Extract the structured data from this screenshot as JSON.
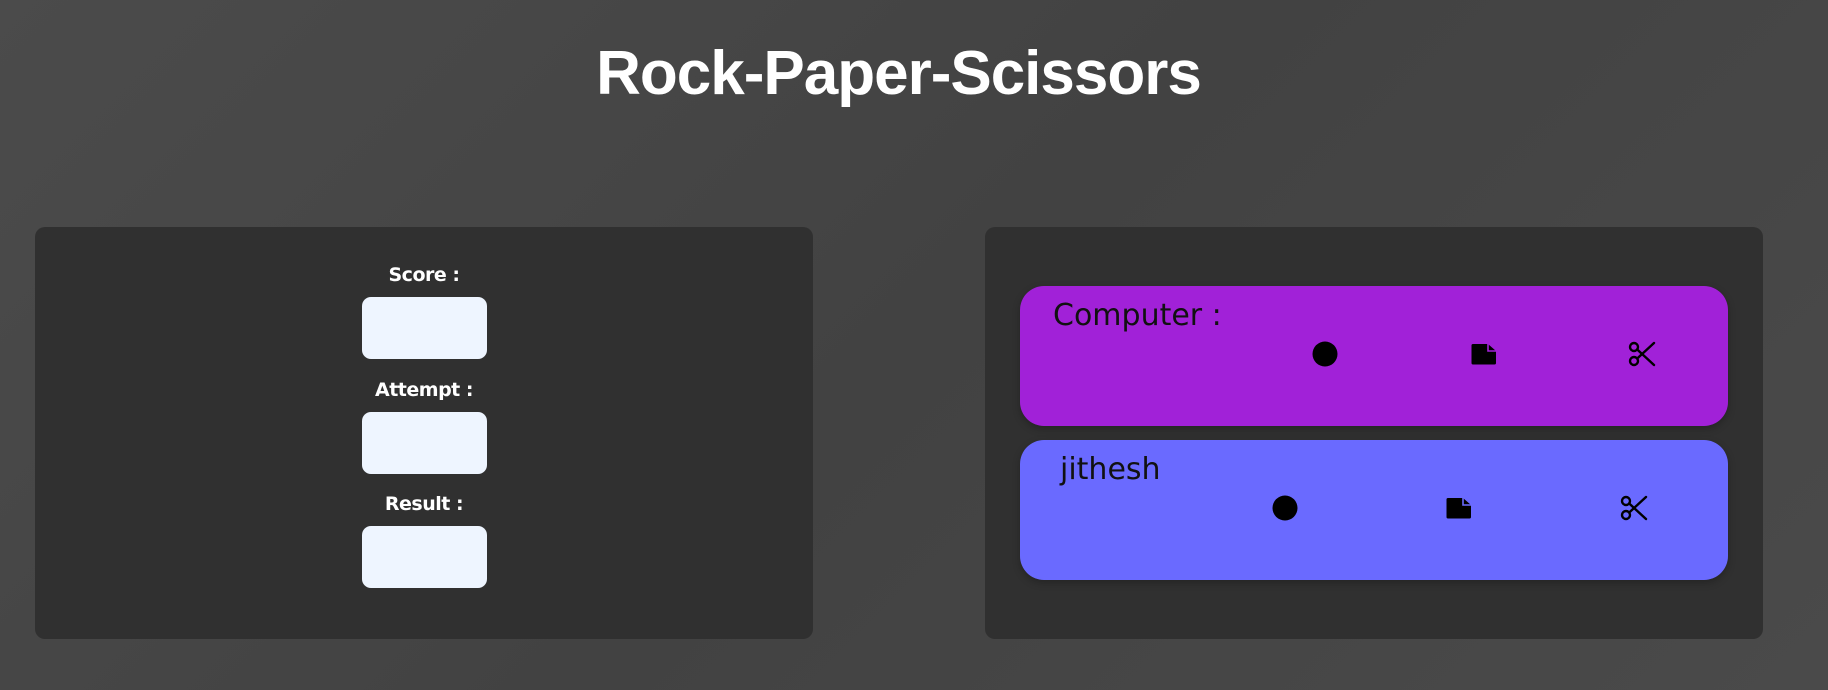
{
  "title": "Rock-Paper-Scissors",
  "stats": {
    "score_label": "Score :",
    "score_value": "",
    "attempt_label": "Attempt :",
    "attempt_value": "",
    "result_label": "Result :",
    "result_value": ""
  },
  "players": {
    "computer": {
      "name": "Computer :",
      "color": "#a121d8",
      "choices": [
        "rock-icon",
        "paper-icon",
        "scissors-icon"
      ]
    },
    "user": {
      "name": "jithesh",
      "color": "#6a6aff",
      "choices": [
        "rock-icon",
        "paper-icon",
        "scissors-icon"
      ]
    }
  },
  "colors": {
    "background": "#474747",
    "panel": "#303030",
    "stat_box": "#eef5ff"
  }
}
